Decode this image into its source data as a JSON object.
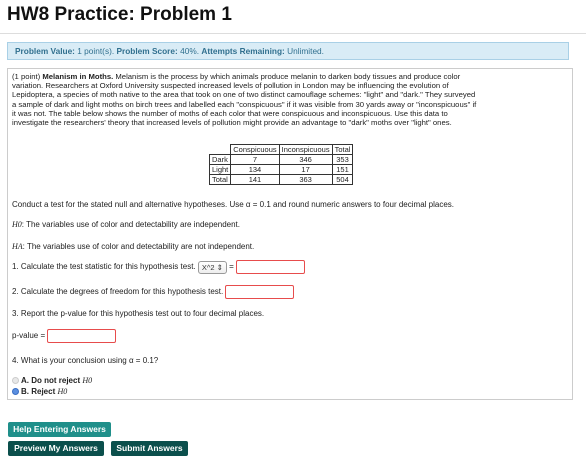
{
  "page": {
    "title": "HW8 Practice: Problem 1"
  },
  "info": {
    "value_label": "Problem Value:",
    "value": "1 point(s).",
    "score_label": "Problem Score:",
    "score": "40%.",
    "attempts_label": "Attempts Remaining:",
    "attempts": "Unlimited."
  },
  "problem": {
    "points": "(1 point)",
    "heading": "Melanism in Moths.",
    "intro_lines": [
      "Melanism is the process by which animals produce melanin to darken body tissues and produce color",
      "variation. Researchers at Oxford University suspected increased levels of pollution in London may be influencing the evolution of",
      "Lepidoptera, a species of moth native to the area that took on one of two distinct camouflage schemes: \"light\" and \"dark.\" They surveyed",
      "a sample of dark and light moths on birch trees and labelled each \"conspicuous\" if it was visible from 30 yards away or \"inconspicuous\" if",
      "it was not. The table below shows the number of moths of each color that were conspicuous and inconspicuous. Use this data to",
      "investigate the researchers' theory that increased levels of pollution might provide an advantage to \"dark\" moths over \"light\" ones."
    ],
    "table": {
      "headers": [
        "",
        "Conspicuous",
        "Inconspicuous",
        "Total"
      ],
      "rows": [
        [
          "Dark",
          "7",
          "346",
          "353"
        ],
        [
          "Light",
          "134",
          "17",
          "151"
        ],
        [
          "Total",
          "141",
          "363",
          "504"
        ]
      ]
    },
    "instruction": "Conduct a test for the stated null and alternative hypotheses. Use α = 0.1 and round numeric answers to four decimal places.",
    "h0_symbol": "H0",
    "h0_text": ": The variables use of color and detectability are independent.",
    "ha_symbol": "HA",
    "ha_text": ": The variables use of color and detectability are not independent.",
    "q1": "1. Calculate the test statistic for this hypothesis test.",
    "q1_select": "X^2 ⇕",
    "q1_equals": "=",
    "q2": "2. Calculate the degrees of freedom for this hypothesis test.",
    "q3": "3. Report the p-value for this hypothesis test out to four decimal places.",
    "pvalue_label": "p-value =",
    "q4": "4. What is your conclusion using α = 0.1?",
    "option_a": "A. Do not reject",
    "option_b": "B. Reject",
    "option_h0": "H0"
  },
  "buttons": {
    "help": "Help Entering Answers",
    "preview": "Preview My Answers",
    "submit": "Submit Answers"
  },
  "colors": {
    "info_bg": "#d9ecf6",
    "info_text": "#31708f",
    "answer_border": "#e74c4c",
    "button_help": "#1f8f8a",
    "button_dark": "#0b4f4c"
  }
}
